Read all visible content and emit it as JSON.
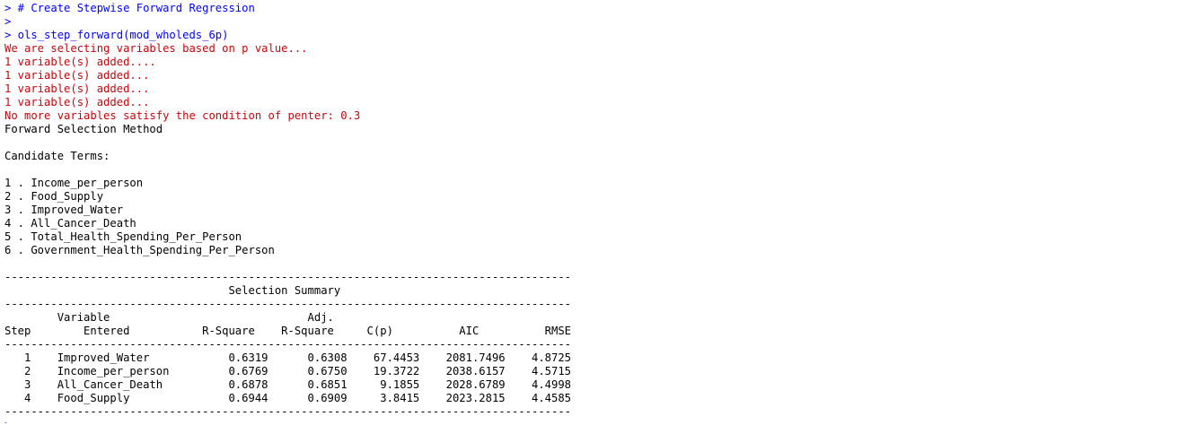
{
  "console": {
    "lines": [
      {
        "text": "> # Create Stepwise Forward Regression",
        "kind": "prompt"
      },
      {
        "text": ">",
        "kind": "prompt"
      },
      {
        "text": "> ols_step_forward(mod_wholeds_6p)",
        "kind": "prompt"
      },
      {
        "text": "We are selecting variables based on p value...",
        "kind": "err"
      },
      {
        "text": "1 variable(s) added....",
        "kind": "err"
      },
      {
        "text": "1 variable(s) added...",
        "kind": "err"
      },
      {
        "text": "1 variable(s) added...",
        "kind": "err"
      },
      {
        "text": "1 variable(s) added...",
        "kind": "err"
      },
      {
        "text": "No more variables satisfy the condition of penter: 0.3",
        "kind": "err"
      },
      {
        "text": "Forward Selection Method",
        "kind": "out"
      },
      {
        "text": "",
        "kind": "out"
      },
      {
        "text": "Candidate Terms:",
        "kind": "out"
      },
      {
        "text": "",
        "kind": "out"
      },
      {
        "text": "1 . Income_per_person",
        "kind": "out"
      },
      {
        "text": "2 . Food_Supply",
        "kind": "out"
      },
      {
        "text": "3 . Improved_Water",
        "kind": "out"
      },
      {
        "text": "4 . All_Cancer_Death",
        "kind": "out"
      },
      {
        "text": "5 . Total_Health_Spending_Per_Person",
        "kind": "out"
      },
      {
        "text": "6 . Government_Health_Spending_Per_Person",
        "kind": "out"
      },
      {
        "text": "",
        "kind": "out"
      },
      {
        "text": "--------------------------------------------------------------------------------------",
        "kind": "out"
      },
      {
        "text": "                                  Selection Summary",
        "kind": "out"
      },
      {
        "text": "--------------------------------------------------------------------------------------",
        "kind": "out"
      },
      {
        "text": "        Variable                              Adj.",
        "kind": "out"
      },
      {
        "text": "Step        Entered           R-Square    R-Square     C(p)          AIC          RMSE",
        "kind": "out"
      },
      {
        "text": "--------------------------------------------------------------------------------------",
        "kind": "out"
      },
      {
        "text": "   1    Improved_Water            0.6319      0.6308    67.4453    2081.7496    4.8725",
        "kind": "out"
      },
      {
        "text": "   2    Income_per_person         0.6769      0.6750    19.3722    2038.6157    4.5715",
        "kind": "out"
      },
      {
        "text": "   3    All_Cancer_Death          0.6878      0.6851     9.1855    2028.6789    4.4998",
        "kind": "out"
      },
      {
        "text": "   4    Food_Supply               0.6944      0.6909     3.8415    2023.2815    4.4585",
        "kind": "out"
      },
      {
        "text": "--------------------------------------------------------------------------------------",
        "kind": "out"
      },
      {
        "text": ">",
        "kind": "prompt"
      }
    ]
  },
  "colors": {
    "prompt": "#0000ff",
    "err": "#c5060b",
    "out": "#000000",
    "background": "#ffffff"
  }
}
